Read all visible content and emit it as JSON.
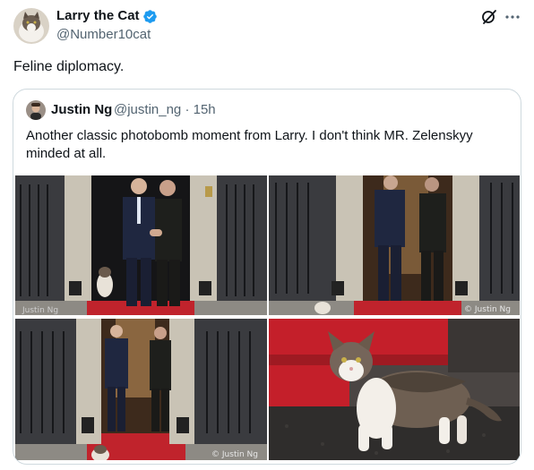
{
  "author": {
    "name": "Larry the Cat",
    "handle": "@Number10cat",
    "verified": true
  },
  "tweet": {
    "text": "Feline diplomacy."
  },
  "actions": {
    "grok_icon": "grok-icon",
    "more_icon": "more-icon"
  },
  "quoted": {
    "name": "Justin Ng",
    "handle_time": "@justin_ng · 15h",
    "text": "Another classic photobomb moment from Larry. I don't think MR. Zelenskyy minded at all.",
    "photos": [
      {
        "watermark": "Justin Ng"
      },
      {
        "watermark": "© Justin Ng"
      },
      {
        "watermark": "© Justin Ng"
      },
      {
        "watermark": ""
      }
    ]
  },
  "colors": {
    "verified_blue": "#1d9bf0",
    "text_primary": "#0f1419",
    "text_secondary": "#536471",
    "card_border": "#cfd9de",
    "door_black": "#1b1b1d",
    "carpet_red": "#c0232c"
  }
}
